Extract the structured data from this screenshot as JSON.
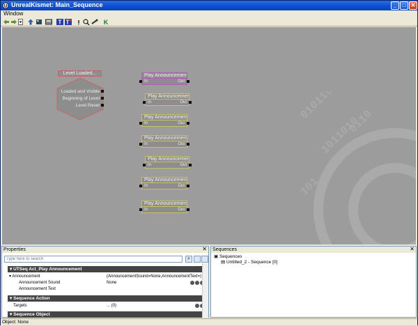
{
  "window": {
    "title": "UnrealKismet: Main_Sequence"
  },
  "menubar": {
    "items": [
      "Window"
    ]
  },
  "toolbar": {
    "icons": [
      "back-icon",
      "forward-icon",
      "dropdown-icon",
      "up-icon",
      "open-icon",
      "save-icon",
      "text-icon",
      "text-search-icon",
      "pin-icon",
      "zoom-icon",
      "link-icon",
      "kismet-icon"
    ]
  },
  "canvas": {
    "event_node": {
      "title": "Level Loaded...",
      "outputs": [
        "Loaded and Visible",
        "Beginning of Level",
        "Level Reset"
      ]
    },
    "nodes": [
      {
        "title": "Play Announcement",
        "in": "In",
        "out": "Out"
      },
      {
        "title": "Play Announcement",
        "in": "In",
        "out": "Out"
      },
      {
        "title": "Play Announcement",
        "in": "In",
        "out": "Out"
      },
      {
        "title": "Play Announcement",
        "in": "In",
        "out": "Out"
      },
      {
        "title": "Play Announcement",
        "in": "In",
        "out": "Out"
      },
      {
        "title": "Play Announcement",
        "in": "In",
        "out": "Out"
      },
      {
        "title": "Play Announcement",
        "in": "In",
        "out": "Out"
      }
    ]
  },
  "properties": {
    "title": "Properties",
    "search_placeholder": "Type here to search",
    "category_main": "UTSeq Act_Play Announcement",
    "rows": {
      "announcement_key": "Announcement",
      "announcement_value": "(AnnouncementSound=None,AnnouncementText=)",
      "sound_key": "Announcement Sound",
      "sound_value": "None",
      "text_key": "Announcement Text"
    },
    "category_action": "Sequence Action",
    "targets_key": "Targets",
    "targets_value": "... (0)",
    "category_object": "Sequence Object"
  },
  "sequences": {
    "title": "Sequences",
    "root": "Sequences",
    "child": "Untitled_2 - Sequence [0]"
  },
  "statusbar": {
    "text": "Object: None"
  },
  "colors": {
    "titlebar": "#0a4ed1",
    "canvas": "#9c9c9c",
    "node_border": "#c9c25d",
    "selected_border": "#b25bb8",
    "event_border": "#cc6666"
  }
}
